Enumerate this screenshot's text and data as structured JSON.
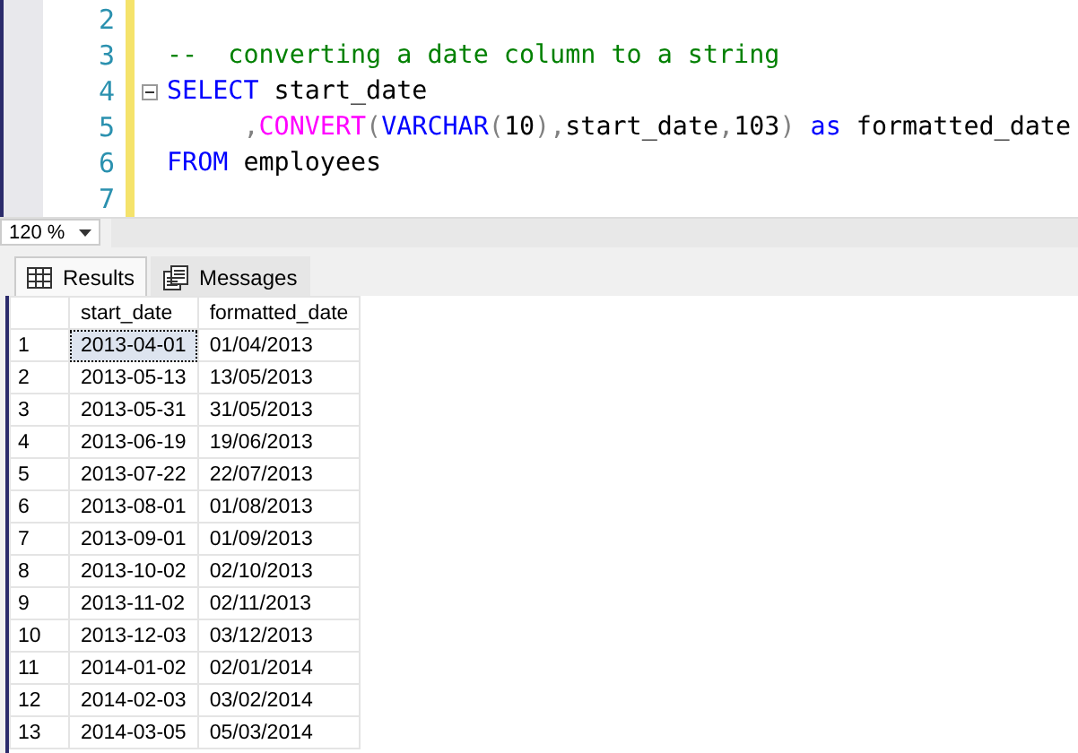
{
  "editor": {
    "lines": [
      {
        "number": "2",
        "fold": false
      },
      {
        "number": "3",
        "fold": false,
        "tokens": [
          {
            "kind": "comment",
            "text": "--  converting a date column to a string"
          }
        ]
      },
      {
        "number": "4",
        "fold": true,
        "tokens": [
          {
            "kind": "keyword",
            "text": "SELECT"
          },
          {
            "kind": "plain",
            "text": " start_date"
          }
        ]
      },
      {
        "number": "5",
        "fold": false,
        "tokens": [
          {
            "kind": "punct",
            "text": "     ,"
          },
          {
            "kind": "function",
            "text": "CONVERT"
          },
          {
            "kind": "punct",
            "text": "("
          },
          {
            "kind": "keyword",
            "text": "VARCHAR"
          },
          {
            "kind": "punct",
            "text": "("
          },
          {
            "kind": "plain",
            "text": "10"
          },
          {
            "kind": "punct",
            "text": "),"
          },
          {
            "kind": "plain",
            "text": "start_date"
          },
          {
            "kind": "punct",
            "text": ","
          },
          {
            "kind": "plain",
            "text": "103"
          },
          {
            "kind": "punct",
            "text": ")"
          },
          {
            "kind": "keyword",
            "text": " as"
          },
          {
            "kind": "plain",
            "text": " formatted_date"
          }
        ]
      },
      {
        "number": "6",
        "fold": false,
        "tokens": [
          {
            "kind": "keyword",
            "text": "FROM"
          },
          {
            "kind": "plain",
            "text": " employees"
          }
        ]
      },
      {
        "number": "7",
        "fold": false
      }
    ]
  },
  "zoom": {
    "value": "120 %"
  },
  "tabs": [
    {
      "label": "Results",
      "selected": true
    },
    {
      "label": "Messages",
      "selected": false
    }
  ],
  "grid": {
    "columns": [
      "start_date",
      "formatted_date"
    ],
    "rows": [
      {
        "number": "1",
        "cells": [
          "2013-04-01",
          "01/04/2013"
        ],
        "selected": true
      },
      {
        "number": "2",
        "cells": [
          "2013-05-13",
          "13/05/2013"
        ],
        "selected": false
      },
      {
        "number": "3",
        "cells": [
          "2013-05-31",
          "31/05/2013"
        ],
        "selected": false
      },
      {
        "number": "4",
        "cells": [
          "2013-06-19",
          "19/06/2013"
        ],
        "selected": false
      },
      {
        "number": "5",
        "cells": [
          "2013-07-22",
          "22/07/2013"
        ],
        "selected": false
      },
      {
        "number": "6",
        "cells": [
          "2013-08-01",
          "01/08/2013"
        ],
        "selected": false
      },
      {
        "number": "7",
        "cells": [
          "2013-09-01",
          "01/09/2013"
        ],
        "selected": false
      },
      {
        "number": "8",
        "cells": [
          "2013-10-02",
          "02/10/2013"
        ],
        "selected": false
      },
      {
        "number": "9",
        "cells": [
          "2013-11-02",
          "02/11/2013"
        ],
        "selected": false
      },
      {
        "number": "10",
        "cells": [
          "2013-12-03",
          "03/12/2013"
        ],
        "selected": false
      },
      {
        "number": "11",
        "cells": [
          "2014-01-02",
          "02/01/2014"
        ],
        "selected": false
      },
      {
        "number": "12",
        "cells": [
          "2014-02-03",
          "03/02/2014"
        ],
        "selected": false
      },
      {
        "number": "13",
        "cells": [
          "2014-03-05",
          "05/03/2014"
        ],
        "selected": false
      }
    ]
  }
}
